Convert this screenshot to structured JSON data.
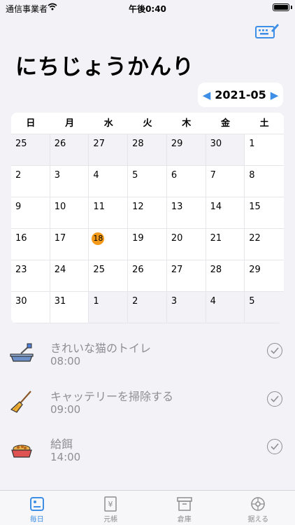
{
  "status_bar": {
    "carrier": "通信事業者",
    "time": "午後0:40"
  },
  "header": {
    "title": "にちじょうかんり",
    "month": "2021-05",
    "prev_icon": "chevron-left-icon",
    "next_icon": "chevron-right-icon"
  },
  "calendar": {
    "weekdays": [
      "日",
      "月",
      "水",
      "火",
      "木",
      "金",
      "土"
    ],
    "days": [
      {
        "d": "25",
        "dim": true
      },
      {
        "d": "26",
        "dim": true
      },
      {
        "d": "27",
        "dim": true
      },
      {
        "d": "28",
        "dim": true
      },
      {
        "d": "29",
        "dim": true
      },
      {
        "d": "30",
        "dim": true
      },
      {
        "d": "1"
      },
      {
        "d": "2"
      },
      {
        "d": "3"
      },
      {
        "d": "4"
      },
      {
        "d": "5"
      },
      {
        "d": "6"
      },
      {
        "d": "7"
      },
      {
        "d": "8"
      },
      {
        "d": "9"
      },
      {
        "d": "10"
      },
      {
        "d": "11"
      },
      {
        "d": "12"
      },
      {
        "d": "13"
      },
      {
        "d": "14"
      },
      {
        "d": "15"
      },
      {
        "d": "16"
      },
      {
        "d": "17"
      },
      {
        "d": "18",
        "today": true
      },
      {
        "d": "19"
      },
      {
        "d": "20"
      },
      {
        "d": "21"
      },
      {
        "d": "22"
      },
      {
        "d": "23"
      },
      {
        "d": "24"
      },
      {
        "d": "25"
      },
      {
        "d": "26"
      },
      {
        "d": "27"
      },
      {
        "d": "28"
      },
      {
        "d": "29"
      },
      {
        "d": "30"
      },
      {
        "d": "31"
      },
      {
        "d": "1",
        "dim": true
      },
      {
        "d": "2",
        "dim": true
      },
      {
        "d": "3",
        "dim": true
      },
      {
        "d": "4",
        "dim": true
      },
      {
        "d": "5",
        "dim": true
      }
    ],
    "today_color": "#f39a1b"
  },
  "tasks": [
    {
      "name": "きれいな猫のトイレ",
      "time": "08:00",
      "icon": "litter-box-icon"
    },
    {
      "name": "キャッテリーを掃除する",
      "time": "09:00",
      "icon": "broom-icon"
    },
    {
      "name": "給餌",
      "time": "14:00",
      "icon": "food-bowl-icon"
    }
  ],
  "tabs": [
    {
      "label": "毎日",
      "icon": "daily-icon",
      "active": true
    },
    {
      "label": "元帳",
      "icon": "ledger-icon",
      "active": false
    },
    {
      "label": "倉庫",
      "icon": "warehouse-icon",
      "active": false
    },
    {
      "label": "据える",
      "icon": "settings-icon",
      "active": false
    }
  ],
  "colors": {
    "accent": "#3d8ee6",
    "today": "#f39a1b",
    "background": "#f2f2f7"
  }
}
